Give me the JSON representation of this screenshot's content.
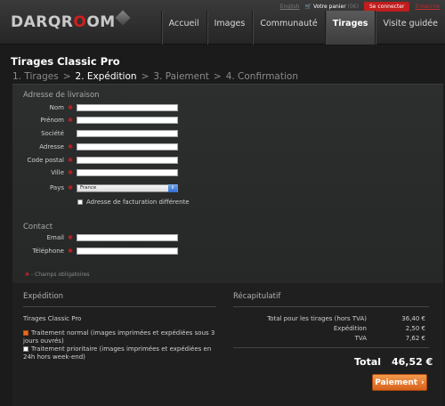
{
  "brand": {
    "logo_before": "DARQR",
    "logo_o": "O",
    "logo_after": "OM"
  },
  "util": {
    "lang": "English",
    "cart_label": "Votre panier",
    "cart_count": "(0€)",
    "login": "Se connecter",
    "register": "S'inscrire"
  },
  "nav": {
    "items": [
      "Accueil",
      "Images",
      "Communauté",
      "Tirages",
      "Visite guidée"
    ]
  },
  "page": {
    "title": "Tirages Classic Pro"
  },
  "steps": {
    "s1": "1. Tirages",
    "s2": "2. Expédition",
    "s3": "3. Paiement",
    "s4": "4. Confirmation",
    "sep": ">"
  },
  "shipping": {
    "title": "Adresse de livraison",
    "fields": {
      "nom": "Nom",
      "prenom": "Prénom",
      "societe": "Société",
      "adresse": "Adresse",
      "code_postal": "Code postal",
      "ville": "Ville",
      "pays": "Pays"
    },
    "country_value": "France",
    "billing_checkbox": "Adresse de facturation différente"
  },
  "contact": {
    "title": "Contact",
    "email": "Email",
    "phone": "Téléphone"
  },
  "required_marker": "✱",
  "required_note": "- Champs obligatoires",
  "expedition": {
    "title": "Expédition",
    "product": "Tirages Classic Pro",
    "opt1": "Traitement normal (images imprimées et expédiées sous 3 jours ouvrés)",
    "opt2": "Traitement prioritaire (images imprimées et expédiées en 24h hors week-end)"
  },
  "summary": {
    "title": "Récapitulatif",
    "total_prints_label": "Total pour les tirages (hors TVA)",
    "total_prints_value": "36,40 €",
    "shipping_label": "Expédition",
    "shipping_value": "2,50 €",
    "vat_label": "TVA",
    "vat_value": "7,62 €",
    "total_label": "Total",
    "total_value": "46,52 €"
  },
  "pay_button": "Paiement",
  "colors": {
    "accent_red": "#c01d1d",
    "pay_orange": "#e8782a"
  }
}
